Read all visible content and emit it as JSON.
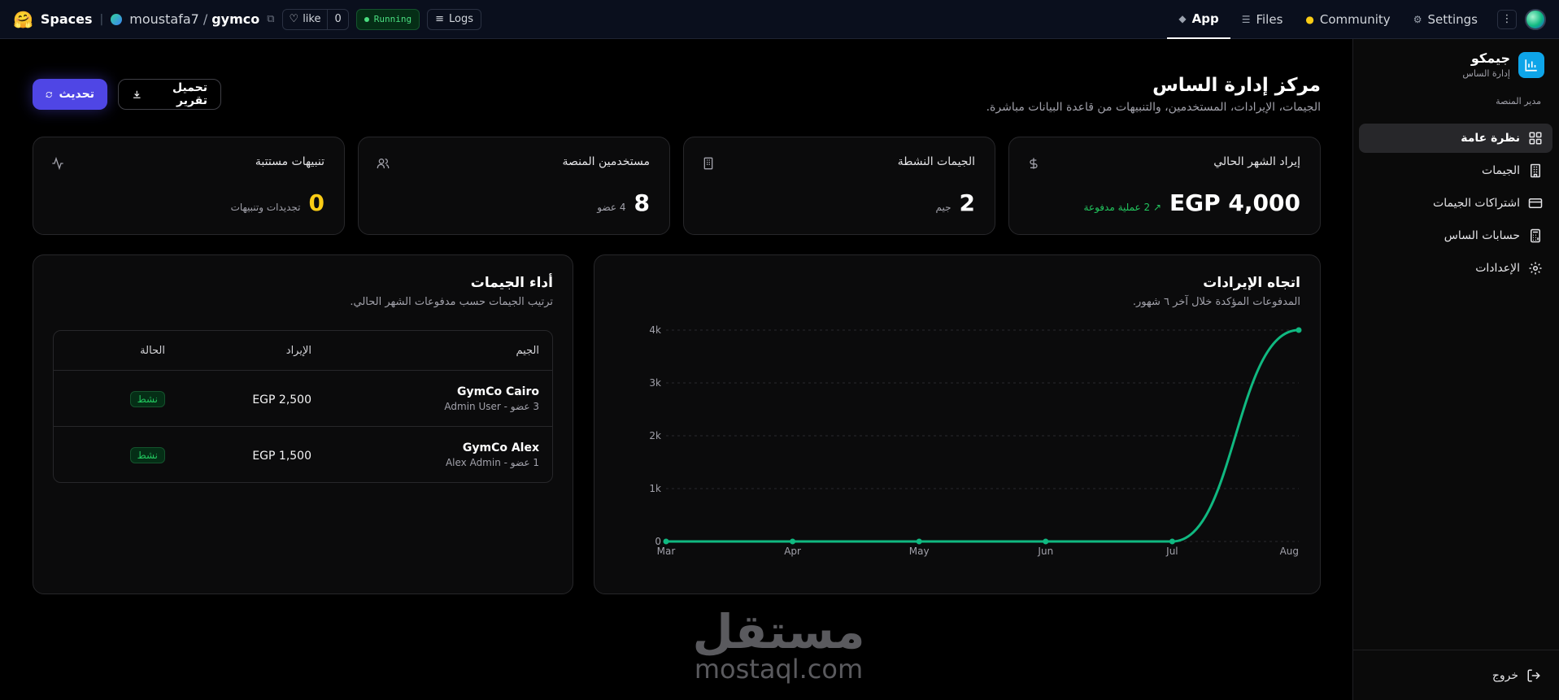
{
  "topbar": {
    "spaces_label": "Spaces",
    "owner": "moustafa7",
    "repo": "gymco",
    "like_label": "like",
    "like_count": "0",
    "status": "Running",
    "logs_label": "Logs",
    "tabs": [
      {
        "label": "App",
        "icon": "cube-icon"
      },
      {
        "label": "Files",
        "icon": "files-icon"
      },
      {
        "label": "Community",
        "icon": "community-icon"
      },
      {
        "label": "Settings",
        "icon": "gear-icon"
      }
    ]
  },
  "sidebar": {
    "brand_name": "جيمكو",
    "brand_sub": "إدارة الساس",
    "role": "مدير المنصة",
    "items": [
      {
        "label": "نظرة عامة",
        "icon": "grid-icon",
        "active": true
      },
      {
        "label": "الجيمات",
        "icon": "building-icon"
      },
      {
        "label": "اشتراكات الجيمات",
        "icon": "card-icon"
      },
      {
        "label": "حسابات الساس",
        "icon": "calculator-icon"
      },
      {
        "label": "الإعدادات",
        "icon": "gear-icon"
      }
    ],
    "logout_label": "خروج"
  },
  "header": {
    "title": "مركز إدارة الساس",
    "subtitle": "الجيمات، الإيرادات، المستخدمين، والتنبيهات من قاعدة البيانات مباشرة.",
    "refresh_label": "تحديث",
    "download_label": "تحميل تقرير"
  },
  "stats": [
    {
      "label": "إيراد الشهر الحالي",
      "value": "EGP 4,000",
      "note": "2 عملية مدفوعة",
      "icon": "dollar-icon"
    },
    {
      "label": "الجيمات النشطة",
      "value": "2",
      "note": "جيم",
      "icon": "building-icon"
    },
    {
      "label": "مستخدمين المنصة",
      "value": "8",
      "note": "4 عضو",
      "icon": "users-icon"
    },
    {
      "label": "تنبيهات مستتبة",
      "value": "0",
      "note": "تجديدات وتنبيهات",
      "icon": "activity-icon"
    }
  ],
  "revenue_panel": {
    "title": "اتجاه الإيرادات",
    "subtitle": "المدفوعات المؤكدة خلال آخر ٦ شهور."
  },
  "performance_panel": {
    "title": "أداء الجيمات",
    "subtitle": "ترتيب الجيمات حسب مدفوعات الشهر الحالي.",
    "columns": [
      "الجيم",
      "الإيراد",
      "الحالة"
    ],
    "rows": [
      {
        "name": "GymCo Cairo",
        "meta": "3 عضو - Admin User",
        "revenue": "EGP 2,500",
        "status": "نشط"
      },
      {
        "name": "GymCo Alex",
        "meta": "1 عضو - Alex Admin",
        "revenue": "EGP 1,500",
        "status": "نشط"
      }
    ]
  },
  "chart_data": {
    "type": "line",
    "x": [
      "Mar",
      "Apr",
      "May",
      "Jun",
      "Jul",
      "Aug"
    ],
    "series": [
      {
        "values": [
          0,
          0,
          0,
          0,
          0,
          4000
        ],
        "color": "#10b981"
      }
    ],
    "ylim": [
      0,
      4000
    ],
    "yticks": [
      0,
      1000,
      2000,
      3000,
      4000
    ],
    "ytick_labels": [
      "0",
      "1k",
      "2k",
      "3k",
      "4k"
    ],
    "grid": true
  },
  "watermark": {
    "arabic": "مستقل",
    "latin": "mostaql.com"
  },
  "colors": {
    "accent": "#4f46e5",
    "line": "#10b981",
    "positive": "#22c55e",
    "warning": "#facc15"
  }
}
